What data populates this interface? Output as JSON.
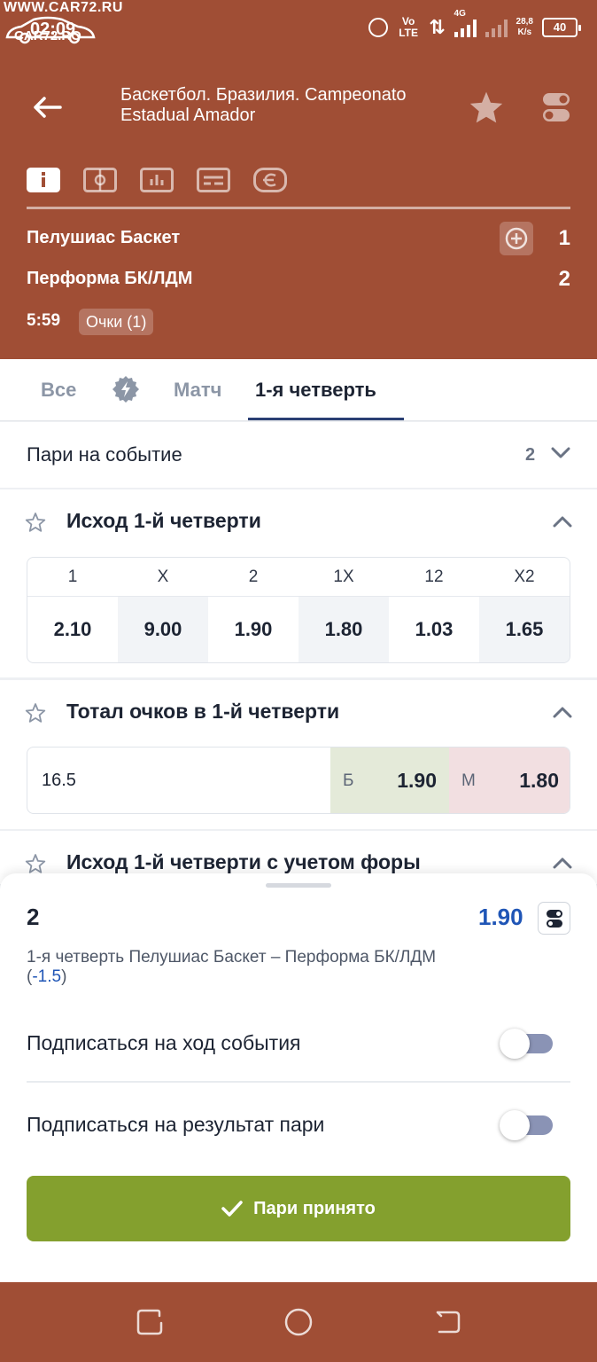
{
  "status_bar": {
    "watermark_top": "WWW.CAR72.RU",
    "time": "02:09",
    "watermark_bottom": "CAR72.RO",
    "network": "Vo LTE",
    "net_type": "4G",
    "speed_value": "28,8",
    "speed_unit": "K/s",
    "battery": "40"
  },
  "header": {
    "title": "Баскетбол. Бразилия. Campeonato Estadual Amador",
    "icon_tabs": [
      "info-icon",
      "field-icon",
      "stats-icon",
      "lineup-icon",
      "euro-icon"
    ],
    "team1": "Пелушиас Баскет",
    "team2": "Перформа БК/ЛДМ",
    "score1": "1",
    "score2": "2",
    "time": "5:59",
    "points_badge": "Очки (1)"
  },
  "tabs": {
    "all": "Все",
    "match": "Матч",
    "q1": "1-я четверть",
    "active": "1-я четверть"
  },
  "events": {
    "label": "Пари на событие",
    "count": "2"
  },
  "market_outcome": {
    "title": "Исход 1-й четверти",
    "columns": [
      {
        "label": "1",
        "odds": "2.10"
      },
      {
        "label": "X",
        "odds": "9.00"
      },
      {
        "label": "2",
        "odds": "1.90"
      },
      {
        "label": "1X",
        "odds": "1.80"
      },
      {
        "label": "12",
        "odds": "1.03"
      },
      {
        "label": "X2",
        "odds": "1.65"
      }
    ]
  },
  "market_total": {
    "title": "Тотал очков в 1-й четверти",
    "line": "16.5",
    "over_label": "Б",
    "over_odds": "1.90",
    "under_label": "М",
    "under_odds": "1.80"
  },
  "market_handicap": {
    "title": "Исход 1-й четверти с учетом форы"
  },
  "bet_sheet": {
    "outcome": "2",
    "odds": "1.90",
    "description": "1-я четверть Пелушиас Баскет – Перформа БК/ЛДМ",
    "handicap_open": "(",
    "handicap_value": "-1.5",
    "handicap_close": ")",
    "subscribe_event": "Подписаться на ход события",
    "subscribe_event_on": false,
    "subscribe_result": "Подписаться на результат пари",
    "subscribe_result_on": false,
    "accept_button": "Пари принято"
  },
  "colors": {
    "brand_brown": "#a04e35",
    "accept_green": "#84a02e",
    "odds_blue": "#1f55b6",
    "over_bg": "#e4ead9",
    "under_bg": "#f2dfe1"
  }
}
